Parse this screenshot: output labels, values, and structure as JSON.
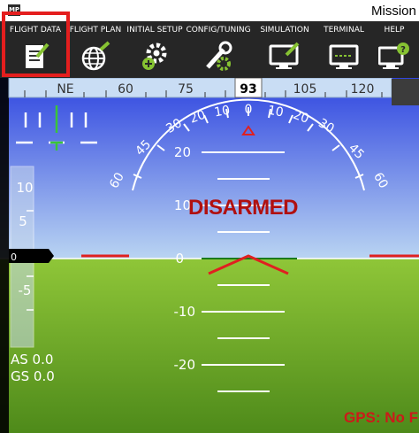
{
  "window": {
    "title": "Mission P",
    "app_icon": "MP"
  },
  "toolbar": {
    "items": [
      {
        "label": "FLIGHT DATA",
        "icon": "flight-data-icon",
        "selected": true
      },
      {
        "label": "FLIGHT PLAN",
        "icon": "flight-plan-icon"
      },
      {
        "label": "INITIAL SETUP",
        "icon": "initial-setup-icon"
      },
      {
        "label": "CONFIG/TUNING",
        "icon": "config-tuning-icon"
      },
      {
        "label": "SIMULATION",
        "icon": "simulation-icon"
      },
      {
        "label": "TERMINAL",
        "icon": "terminal-icon"
      },
      {
        "label": "HELP",
        "icon": "help-icon"
      }
    ]
  },
  "hud": {
    "heading": {
      "value": "93",
      "ticks": [
        "NE",
        "60",
        "75",
        "105",
        "120"
      ]
    },
    "roll_scale": [
      "60",
      "45",
      "30",
      "20",
      "10",
      "0",
      "10",
      "20",
      "30",
      "45",
      "60"
    ],
    "pitch_ladder": [
      "20",
      "10",
      "0",
      "-10",
      "-20"
    ],
    "speed_tape": [
      "10",
      "5",
      "0",
      "-5"
    ],
    "speed_value": "0",
    "status": "DISARMED",
    "airspeed": "AS 0.0",
    "groundspeed": "GS 0.0",
    "gps_status": "GPS: No F"
  },
  "colors": {
    "sky_top": "#2f45e0",
    "sky_bottom": "#b9d4f2",
    "ground_top": "#8fc638",
    "ground_bottom": "#4e8a1a",
    "toolbar_bg": "#262626",
    "selection": "#e41e1e",
    "warning_text": "#b01010",
    "horizon_markers": "#e02020",
    "icon_green": "#86c232"
  }
}
